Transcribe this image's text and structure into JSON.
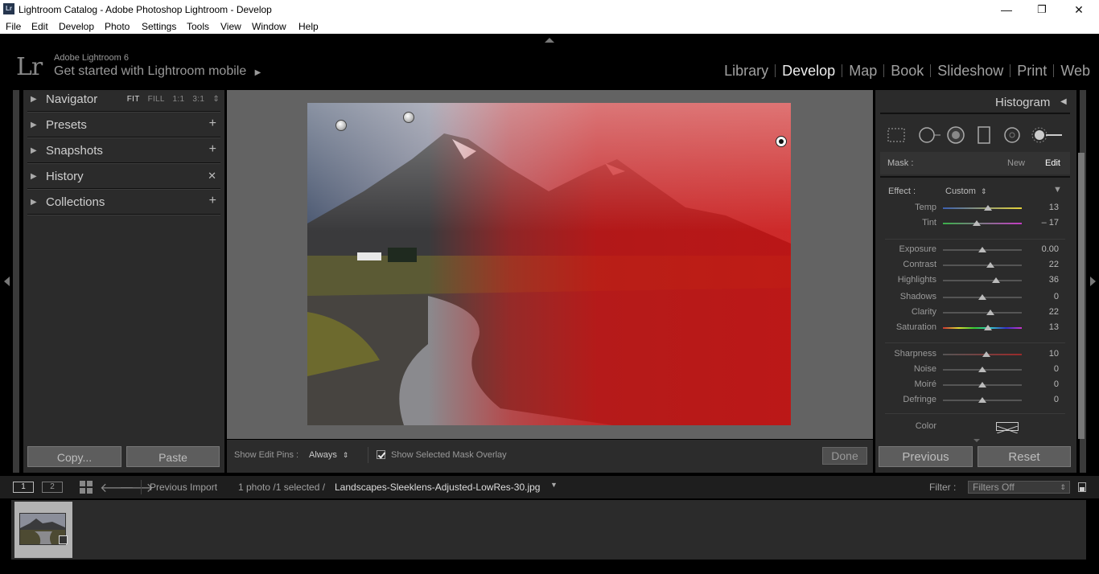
{
  "window": {
    "app_icon": "Lr",
    "title": "Lightroom Catalog - Adobe Photoshop Lightroom - Develop",
    "minimize": "—",
    "maximize": "❐",
    "close": "✕"
  },
  "menu": [
    "File",
    "Edit",
    "Develop",
    "Photo",
    "Settings",
    "Tools",
    "View",
    "Window",
    "Help"
  ],
  "identity": {
    "logo": "Lr",
    "version": "Adobe Lightroom 6",
    "mobile": "Get started with Lightroom mobile",
    "mobile_arrow": "▶"
  },
  "modules": [
    "Library",
    "Develop",
    "Map",
    "Book",
    "Slideshow",
    "Print",
    "Web"
  ],
  "active_module": "Develop",
  "left_panel": {
    "navigator": {
      "label": "Navigator",
      "options": [
        "FIT",
        "FILL",
        "1:1",
        "3:1"
      ],
      "active_option": "FIT",
      "spinner": "⇕"
    },
    "sections": [
      {
        "label": "Presets",
        "action": "+"
      },
      {
        "label": "Snapshots",
        "action": "+"
      },
      {
        "label": "History",
        "action": "✕"
      },
      {
        "label": "Collections",
        "action": "+"
      }
    ],
    "copy_button": "Copy...",
    "paste_button": "Paste"
  },
  "toolbar": {
    "show_edit_pins_label": "Show Edit Pins :",
    "show_edit_pins_value": "Always",
    "show_mask_overlay_label": "Show Selected Mask Overlay",
    "show_mask_overlay_checked": true,
    "done_button": "Done",
    "updown": "⇕"
  },
  "right_panel": {
    "histogram_label": "Histogram",
    "histogram_arrow": "◀",
    "tools": [
      "crop-overlay-icon",
      "spot-removal-icon",
      "red-eye-icon",
      "graduated-filter-icon",
      "radial-filter-icon",
      "adjustment-brush-icon"
    ],
    "mask_label": "Mask :",
    "mask_new": "New",
    "mask_edit": "Edit",
    "effect_label": "Effect :",
    "effect_value": "Custom",
    "effect_spinner": "⇕",
    "sliders": [
      {
        "label": "Temp",
        "value": "13"
      },
      {
        "label": "Tint",
        "value": "– 17"
      },
      {
        "label": "Exposure",
        "value": "0.00"
      },
      {
        "label": "Contrast",
        "value": "22"
      },
      {
        "label": "Highlights",
        "value": "36"
      },
      {
        "label": "Shadows",
        "value": "0"
      },
      {
        "label": "Clarity",
        "value": "22"
      },
      {
        "label": "Saturation",
        "value": "13"
      },
      {
        "label": "Sharpness",
        "value": "10"
      },
      {
        "label": "Noise",
        "value": "0"
      },
      {
        "label": "Moiré",
        "value": "0"
      },
      {
        "label": "Defringe",
        "value": "0"
      }
    ],
    "color_label": "Color",
    "previous_button": "Previous",
    "reset_button": "Reset"
  },
  "filmstrip_bar": {
    "screen1": "1",
    "screen2": "2",
    "source": "Previous Import",
    "count": "1 photo /1 selected /",
    "filename": "Landscapes-Sleeklens-Adjusted-LowRes-30.jpg",
    "filter_label": "Filter :",
    "filter_value": "Filters Off"
  },
  "colors": {
    "accent": "#cfcfcf",
    "mask_overlay": "#d01010",
    "panel": "#2b2b2b",
    "background": "#636363"
  }
}
